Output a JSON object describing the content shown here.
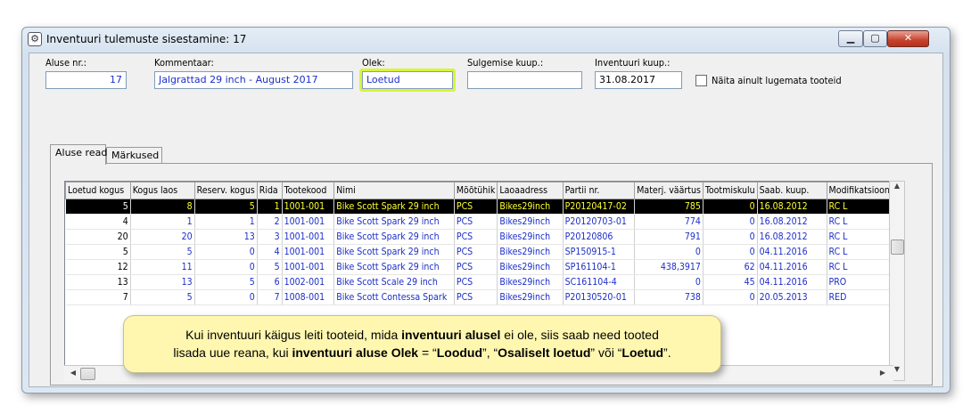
{
  "window": {
    "title": "Inventuuri tulemuste sisestamine: 17",
    "min_glyph": "▁",
    "max_glyph": "▢",
    "close_glyph": "✕",
    "icon_glyph": "⚙"
  },
  "form": {
    "alus_label": "Aluse nr.:",
    "alus_value": "17",
    "kommentaar_label": "Kommentaar:",
    "kommentaar_value": "Jalgrattad 29 inch - August 2017",
    "olek_label": "Olek:",
    "olek_value": "Loetud",
    "sulgemise_label": "Sulgemise kuup.:",
    "sulgemise_value": "",
    "inventuuri_label": "Inventuuri kuup.:",
    "inventuuri_value": "31.08.2017",
    "naita_label": "Näita ainult lugemata tooteid"
  },
  "tabs": [
    {
      "label": "Aluse read"
    },
    {
      "label": "Märkused"
    }
  ],
  "grid": {
    "columns": [
      "Loetud kogus",
      "Kogus laos",
      "Reserv. kogus",
      "Rida",
      "Tootekood",
      "Nimi",
      "Mõõtühik",
      "Laoaadress",
      "Partii nr.",
      "Materj. väärtus",
      "Tootmiskulu",
      "Saab. kuup.",
      "Modifikatsioon"
    ],
    "rows": [
      [
        "5",
        "8",
        "5",
        "1",
        "1001-001",
        "Bike Scott Spark 29 inch",
        "PCS",
        "Bikes29inch",
        "P20120417-02",
        "785",
        "0",
        "16.08.2012",
        "RC L"
      ],
      [
        "4",
        "1",
        "1",
        "2",
        "1001-001",
        "Bike Scott Spark 29 inch",
        "PCS",
        "Bikes29inch",
        "P20120703-01",
        "774",
        "0",
        "16.08.2012",
        "RC L"
      ],
      [
        "20",
        "20",
        "13",
        "3",
        "1001-001",
        "Bike Scott Spark 29 inch",
        "PCS",
        "Bikes29inch",
        "P20120806",
        "791",
        "0",
        "16.08.2012",
        "RC L"
      ],
      [
        "5",
        "5",
        "0",
        "4",
        "1001-001",
        "Bike Scott Spark 29 inch",
        "PCS",
        "Bikes29inch",
        "SP150915-1",
        "0",
        "0",
        "04.11.2016",
        "RC L"
      ],
      [
        "12",
        "11",
        "0",
        "5",
        "1001-001",
        "Bike Scott Spark 29 inch",
        "PCS",
        "Bikes29inch",
        "SP161104-1",
        "438,3917",
        "62",
        "04.11.2016",
        "RC L"
      ],
      [
        "13",
        "13",
        "5",
        "6",
        "1002-001",
        "Bike Scott Scale 29 inch",
        "PCS",
        "Bikes29inch",
        "SC161104-4",
        "0",
        "45",
        "04.11.2016",
        "PRO"
      ],
      [
        "7",
        "5",
        "0",
        "7",
        "1008-001",
        "Bike Scott Contessa Spark",
        "PCS",
        "Bikes29inch",
        "P20130520-01",
        "738",
        "0",
        "20.05.2013",
        "RED"
      ]
    ],
    "selected_row": 0
  },
  "callout": {
    "t1": "Kui inventuuri käigus leiti tooteid, mida ",
    "b1": "inventuuri alusel",
    "t2": " ei ole, siis saab need tooted",
    "t3": "lisada uue reana, kui ",
    "b2": "inventuuri aluse Olek",
    "t4": " = “",
    "b3": "Loodud",
    "t5": "”, “",
    "b4": "Osaliselt loetud",
    "t6": "” või “",
    "b5": "Loetud",
    "t7": "”."
  }
}
